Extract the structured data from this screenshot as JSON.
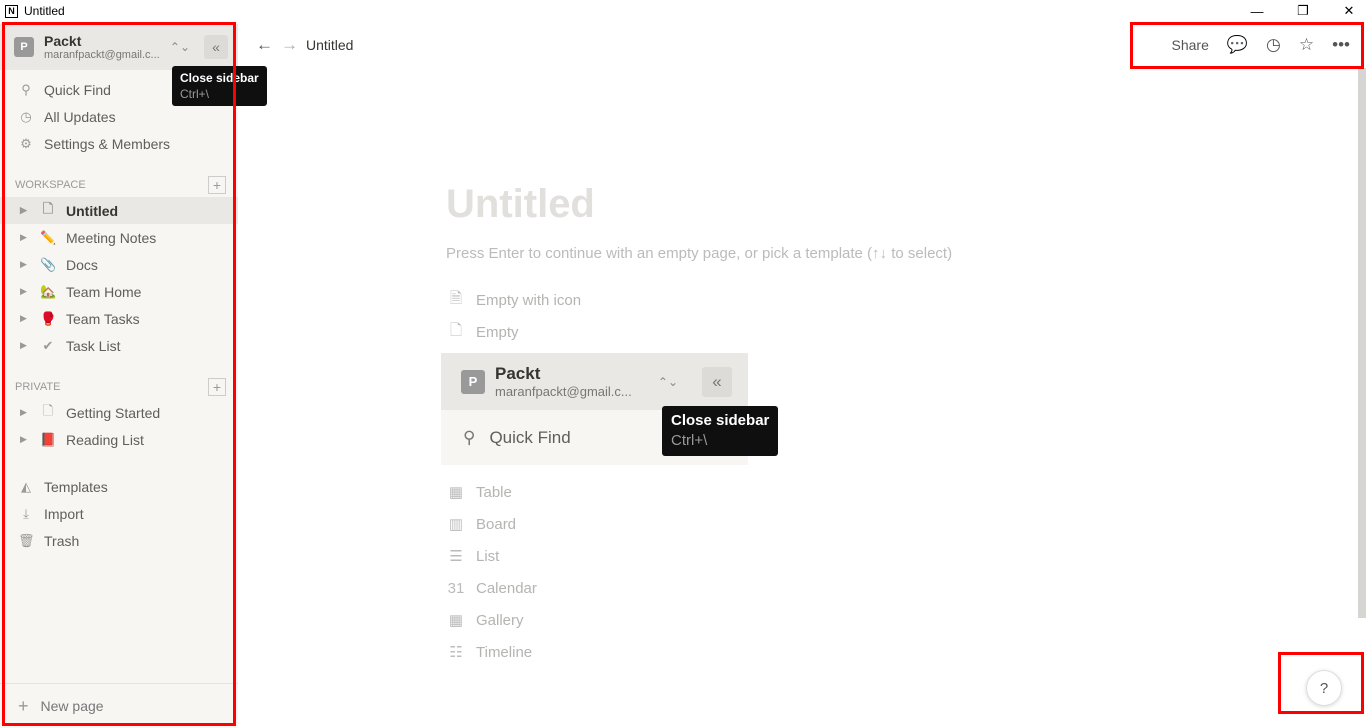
{
  "window": {
    "title": "Untitled",
    "logo": "N",
    "minimize": "—",
    "restore": "❐",
    "close": "✕"
  },
  "workspace": {
    "initial": "P",
    "name": "Packt",
    "email": "maranfpackt@gmail.c...",
    "switch_icon": "⌃⌄",
    "close_icon": "«"
  },
  "tooltip": {
    "title": "Close sidebar",
    "shortcut": "Ctrl+\\"
  },
  "sidebar": {
    "top_items": [
      {
        "icon": "⚲",
        "label": "Quick Find"
      },
      {
        "icon": "◷",
        "label": "All Updates"
      },
      {
        "icon": "⚙",
        "label": "Settings & Members"
      }
    ],
    "workspace_label": "WORKSPACE",
    "workspace_pages": [
      {
        "icon": "🗋",
        "label": "Untitled"
      },
      {
        "icon": "✏️",
        "label": "Meeting Notes"
      },
      {
        "icon": "📎",
        "label": "Docs"
      },
      {
        "icon": "🏡",
        "label": "Team Home"
      },
      {
        "icon": "🥊",
        "label": "Team Tasks"
      },
      {
        "icon": "✔",
        "label": "Task List"
      }
    ],
    "private_label": "PRIVATE",
    "private_pages": [
      {
        "icon": "🗋",
        "label": "Getting Started"
      },
      {
        "icon": "📕",
        "label": "Reading List"
      }
    ],
    "bottom_items": [
      {
        "icon": "◭",
        "label": "Templates"
      },
      {
        "icon": "⤓",
        "label": "Import"
      },
      {
        "icon": "🗑",
        "label": "Trash"
      }
    ],
    "new_page": "New page",
    "plus": "+"
  },
  "topbar": {
    "back": "←",
    "forward": "→",
    "breadcrumb": "Untitled",
    "share": "Share",
    "comment_icon": "💬",
    "history_icon": "◷",
    "favorite_icon": "☆",
    "more_icon": "•••"
  },
  "page": {
    "title": "Untitled",
    "hint": "Press Enter to continue with an empty page, or pick a template (↑↓ to select)",
    "templates_top": [
      {
        "icon": "🗎",
        "label": "Empty with icon"
      },
      {
        "icon": "🗋",
        "label": "Empty"
      }
    ],
    "templates": [
      {
        "icon": "▦",
        "label": "Table"
      },
      {
        "icon": "▥",
        "label": "Board"
      },
      {
        "icon": "☰",
        "label": "List"
      },
      {
        "icon": "31",
        "label": "Calendar"
      },
      {
        "icon": "▦",
        "label": "Gallery"
      },
      {
        "icon": "☷",
        "label": "Timeline"
      }
    ]
  },
  "inset": {
    "quick_find": "Quick Find",
    "search_icon": "⚲"
  },
  "help": "?"
}
